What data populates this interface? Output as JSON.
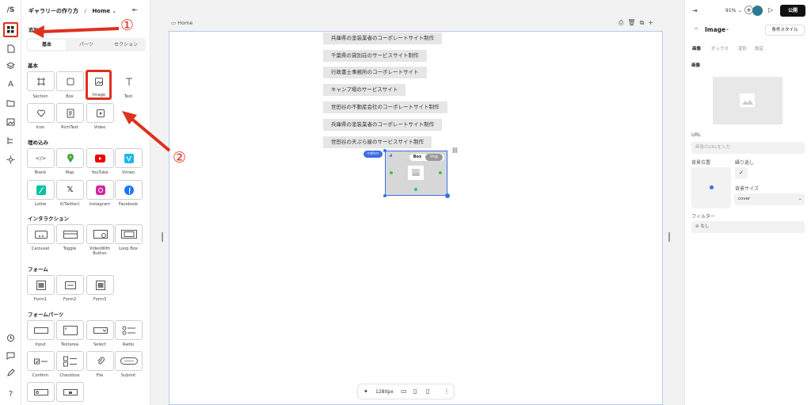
{
  "logo": "/S",
  "sidebar": {
    "project": "ギャラリーの作り方",
    "sep": "/",
    "page": "Home",
    "collapse": "⇤",
    "add_label": "追加"
  },
  "tabs": [
    "基本",
    "パーツ",
    "セクション"
  ],
  "sections": {
    "basic": "基本",
    "embed": "埋め込み",
    "interaction": "インタラクション",
    "form": "フォーム",
    "form_parts": "フォームパーツ"
  },
  "basic_items": [
    "Section",
    "Box",
    "Image",
    "Text",
    "Icon",
    "RichText",
    "Video"
  ],
  "embed_items": [
    "Blank",
    "Map",
    "YouTube",
    "Vimeo",
    "Lottie",
    "X(Twitter)",
    "Instagram",
    "Facebook"
  ],
  "interaction_items": [
    "Carousel",
    "Toggle",
    "VideoWith Button",
    "Loop Box"
  ],
  "form_items": [
    "Form1",
    "Form2",
    "Form3"
  ],
  "form_parts_items": [
    "Input",
    "Textarea",
    "Select",
    "Radio",
    "Confirm",
    "Checkbox",
    "File",
    "Submit"
  ],
  "canvas": {
    "breadcrumb": "Home",
    "div_badge": "<div>",
    "box_tab": "Box",
    "img_tab": "Img",
    "viewport": "1280px",
    "more": "⋮",
    "add": "+"
  },
  "gallery_items": [
    "兵庫県の塗装業者のコーポレートサイト制作",
    "千葉県の貸別荘のサービスサイト制作",
    "行政書士事務所のコーポレートサイト",
    "キャンプ場のサービスサイト",
    "世田谷の不動産会社のコーポレートサイト制作",
    "兵庫県の塗装業者のコーポレートサイト制作",
    "世田谷の天ぷら屋のサービスサイト制作"
  ],
  "topbar": {
    "zoom": "91%",
    "publish": "公開"
  },
  "inspector": {
    "element": "Image",
    "cond_style": "条件スタイル",
    "tabs": [
      "画像",
      "ボックス",
      "変形",
      "設定"
    ],
    "image_heading": "画像",
    "url_label": "URL",
    "url_placeholder": "画像のURLを入力",
    "bg_pos": "背景位置",
    "repeat": "繰り返し",
    "bg_size": "背景サイズ",
    "bg_size_value": "cover",
    "filter": "フィルター",
    "filter_value": "なし"
  },
  "annotations": {
    "n1": "①",
    "n2": "②"
  },
  "colors": {
    "accent": "#3b6fe6",
    "annot": "#e0301e"
  }
}
